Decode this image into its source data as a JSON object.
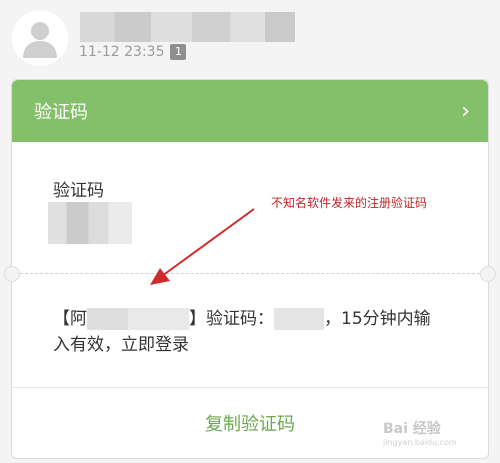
{
  "message_header": {
    "timestamp": "11-12 23:35",
    "sim_badge": "1"
  },
  "card": {
    "title": "验证码",
    "chevron_icon": "chevron-right-icon",
    "code_label": "验证码",
    "message_prefix": "【阿",
    "message_mid": "】验证码：",
    "message_suffix": "，15分钟内输",
    "message_line2": "入有效，立即登录",
    "copy_button_label": "复制验证码"
  },
  "annotation": {
    "text": "不知名软件发来的注册验证码",
    "color": "#c0262a"
  },
  "watermark": {
    "logo_text": "Bai 经验",
    "url": "jingyan.baidu.com"
  },
  "colors": {
    "header_green": "#84c06a",
    "button_green": "#6aa84f"
  }
}
